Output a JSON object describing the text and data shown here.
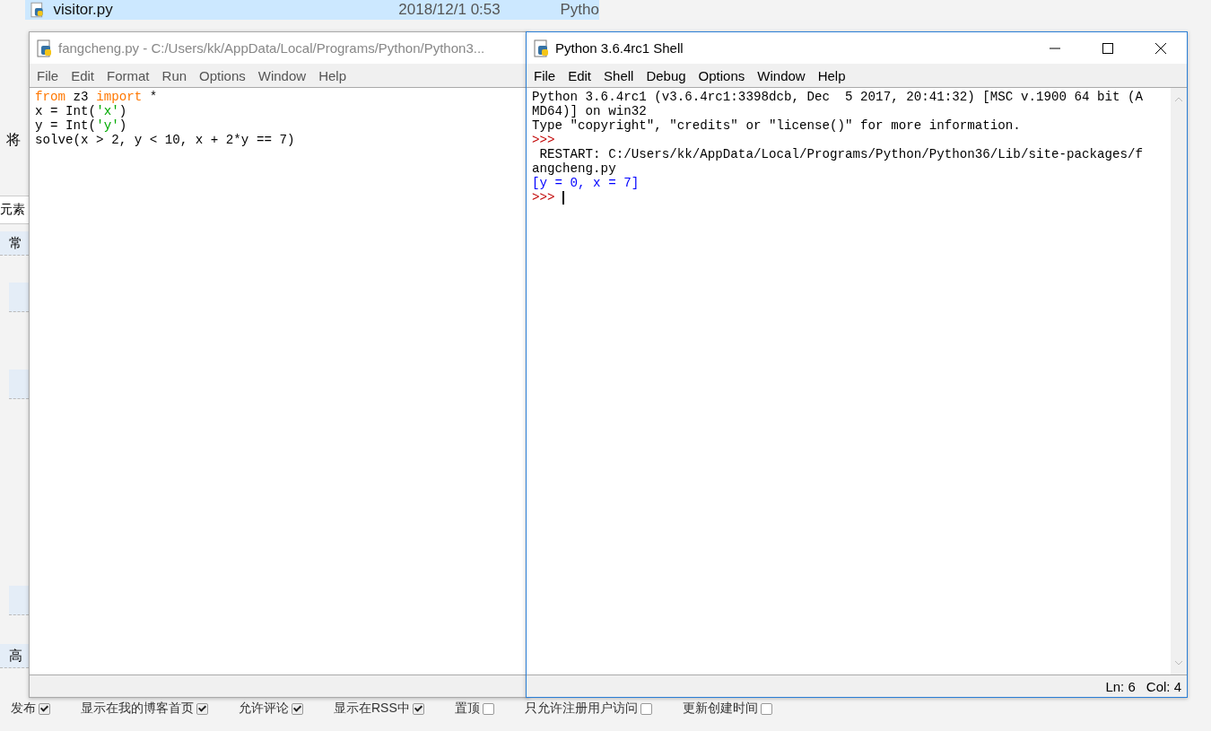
{
  "file_list": {
    "rows": [
      {
        "name": "visitor.py",
        "date": "2018/12/1 0:53",
        "type": "Pytho"
      }
    ]
  },
  "background_page": {
    "intro_text": "将",
    "tab_label": "元素",
    "section_top": "常",
    "section_bottom": "高",
    "options": [
      {
        "label": "发布",
        "checked": true
      },
      {
        "label": "显示在我的博客首页",
        "checked": true
      },
      {
        "label": "允许评论",
        "checked": true
      },
      {
        "label": "显示在RSS中",
        "checked": true
      },
      {
        "label": "置顶",
        "checked": false
      },
      {
        "label": "只允许注册用户访问",
        "checked": false
      },
      {
        "label": "更新创建时间",
        "checked": false
      }
    ]
  },
  "editor_window": {
    "title": "fangcheng.py - C:/Users/kk/AppData/Local/Programs/Python/Python3...",
    "active": false,
    "menu": [
      "File",
      "Edit",
      "Format",
      "Run",
      "Options",
      "Window",
      "Help"
    ],
    "lines": [
      [
        {
          "kind": "keyword",
          "text": "from"
        },
        {
          "kind": "plain",
          "text": " z3 "
        },
        {
          "kind": "keyword",
          "text": "import"
        },
        {
          "kind": "plain",
          "text": " *"
        }
      ],
      [
        {
          "kind": "plain",
          "text": "x = Int("
        },
        {
          "kind": "string",
          "text": "'x'"
        },
        {
          "kind": "plain",
          "text": ")"
        }
      ],
      [
        {
          "kind": "plain",
          "text": "y = Int("
        },
        {
          "kind": "string",
          "text": "'y'"
        },
        {
          "kind": "plain",
          "text": ")"
        }
      ],
      [
        {
          "kind": "plain",
          "text": "solve(x > 2, y < 10, x + 2*y == 7)"
        }
      ]
    ]
  },
  "shell_window": {
    "title": "Python 3.6.4rc1 Shell",
    "active": true,
    "menu": [
      "File",
      "Edit",
      "Shell",
      "Debug",
      "Options",
      "Window",
      "Help"
    ],
    "lines": [
      {
        "kind": "output",
        "text": "Python 3.6.4rc1 (v3.6.4rc1:3398dcb, Dec  5 2017, 20:41:32) [MSC v.1900 64 bit (A"
      },
      {
        "kind": "output",
        "text": "MD64)] on win32"
      },
      {
        "kind": "output",
        "text": "Type \"copyright\", \"credits\" or \"license()\" for more information."
      },
      {
        "kind": "prompt",
        "text": ">>>"
      },
      {
        "kind": "output",
        "text": " RESTART: C:/Users/kk/AppData/Local/Programs/Python/Python36/Lib/site-packages/f"
      },
      {
        "kind": "output",
        "text": "angcheng.py"
      },
      {
        "kind": "result",
        "text": "[y = 0, x = 7]"
      },
      {
        "kind": "prompt",
        "text": ">>>",
        "cursor": true
      }
    ],
    "status": {
      "line": "Ln: 6",
      "column": "Col: 4"
    }
  }
}
